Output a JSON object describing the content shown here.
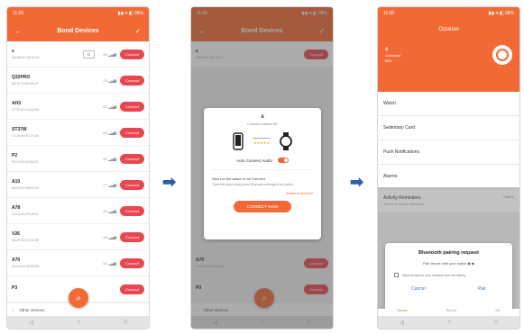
{
  "status": {
    "time": "11:00",
    "icons": "▮◉ ▾ ◧ 98%"
  },
  "screen1": {
    "title": "Bond Devices",
    "rescan_label": "↻",
    "devices": [
      {
        "name": "s",
        "mac": "DA:D8:0C:35:40:E1",
        "signal": "-59 ▂▄▆",
        "btn": "Connect"
      },
      {
        "name": "Q32PRO",
        "mac": "5B:7E:10:96:0B:1F",
        "signal": "-76 ▂▄▆",
        "btn": "Connect"
      },
      {
        "name": "AH3",
        "mac": "07:3F:51:C4:AA:8D",
        "signal": "-62 ▂▄▆",
        "btn": "Connect"
      },
      {
        "name": "ST37W",
        "mac": "C1:20:6B:E2:71:55",
        "signal": "-63 ▂▄▆",
        "btn": "Connect"
      },
      {
        "name": "P2",
        "mac": "F8:74:93:1C:06:2D",
        "signal": "-81 ▂▄▆",
        "btn": "Connect"
      },
      {
        "name": "A10",
        "mac": "9E:33:D7:58:BC:90",
        "signal": "-77 ▂▄▆",
        "btn": "Connect"
      },
      {
        "name": "A78",
        "mac": "24:C6:0A:FD:13:67",
        "signal": "-64 ▂▄▆",
        "btn": "Connect"
      },
      {
        "name": "V26",
        "mac": "6A:0F:B2:47:D9:3E",
        "signal": "-85 ▂▄▆",
        "btn": "Connect"
      },
      {
        "name": "A70",
        "mac": "3D:91:EC:28:5A:B4",
        "signal": "-92 ▂▄▆",
        "btn": "Connect"
      },
      {
        "name": "P3",
        "mac": "",
        "signal": "",
        "btn": "Connect"
      }
    ],
    "other_devices": "Other devices"
  },
  "screen2": {
    "title": "Bond Devices",
    "dialog": {
      "title": "s",
      "subtitle": "Connect classic BT",
      "rating": "★★★★★",
      "toggle_label": "Auto Connect Audio",
      "hint_title": "Now Let the watch to be Connect",
      "hint_body": "Open the watch and phone bluetooth settings to be paired",
      "link": "Unable to connect?",
      "button": "CONNECT NOW"
    },
    "footer_text": "Other devices",
    "peek_rows": [
      {
        "name": "s",
        "mac": "DA:D8:0C:35:40:E1",
        "btn": "Connect"
      },
      {
        "name": "A70",
        "mac": "3D:91:EC:28:5A:B4",
        "btn": "Connect"
      },
      {
        "name": "P3",
        "mac": "",
        "btn": "Connect"
      }
    ]
  },
  "screen3": {
    "title": "Ostation",
    "device_name": "s",
    "device_sub": "Connected",
    "device_sub2": "86%",
    "menu": [
      {
        "label": "Watch",
        "sub": ""
      },
      {
        "label": "Sedentary Card",
        "sub": ""
      },
      {
        "label": "Push Notifications",
        "sub": ""
      },
      {
        "label": "Alarms",
        "sub": ""
      },
      {
        "label": "Activity Reminders",
        "sub": "Turn on to receive reminders",
        "value": "Disable"
      }
    ],
    "pairing": {
      "title": "Bluetooth pairing request",
      "body": "Pair device with your watch ◆ ◆",
      "checkbox_label": "Allow access to your contacts and call history",
      "cancel": "Cancel",
      "pair": "Pair"
    },
    "tabs": [
      "Device",
      "Record",
      "Me"
    ]
  },
  "nav": {
    "back": "◁",
    "home": "○",
    "recent": "□"
  },
  "arrow": "➡"
}
